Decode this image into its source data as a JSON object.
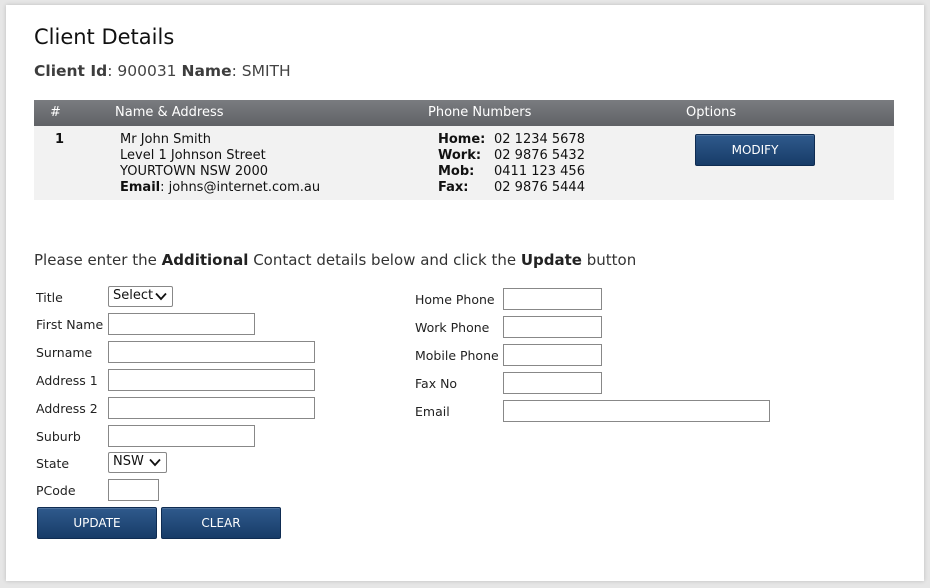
{
  "page": {
    "title": "Client Details",
    "client_id_label": "Client Id",
    "client_id_value": "900031",
    "name_label": "Name",
    "name_value": "SMITH"
  },
  "table": {
    "columns": [
      "#",
      "Name & Address",
      "Phone Numbers",
      "Options"
    ],
    "row": {
      "number": "1",
      "name": "Mr John Smith",
      "address_line1": "Level 1 Johnson Street",
      "address_line2": "YOURTOWN NSW 2000",
      "email_label": "Email",
      "email": "johns@internet.com.au",
      "phones": [
        {
          "label": "Home:",
          "value": "02 1234 5678"
        },
        {
          "label": "Work:",
          "value": "02 9876 5432"
        },
        {
          "label": "Mob:",
          "value": "0411 123 456"
        },
        {
          "label": "Fax:",
          "value": "02 9876 5444"
        }
      ],
      "modify_label": "MODIFY"
    }
  },
  "instructions": {
    "pre": "Please enter the ",
    "bold1": "Additional",
    "mid": " Contact details below and click the ",
    "bold2": "Update",
    "post": " button"
  },
  "form": {
    "left_labels": {
      "title": "Title",
      "first_name": "First Name",
      "surname": "Surname",
      "address1": "Address 1",
      "address2": "Address 2",
      "suburb": "Suburb",
      "state": "State",
      "pcode": "PCode"
    },
    "title_selected": "Select",
    "state_selected": "NSW",
    "right_labels": {
      "home_phone": "Home Phone",
      "work_phone": "Work Phone",
      "mobile_phone": "Mobile Phone",
      "fax_no": "Fax No",
      "email": "Email"
    },
    "update_label": "UPDATE",
    "clear_label": "CLEAR"
  },
  "colors": {
    "header_bg": "#6d6f73",
    "row_bg": "#f2f2f2",
    "button_bg": "#1f4677"
  }
}
